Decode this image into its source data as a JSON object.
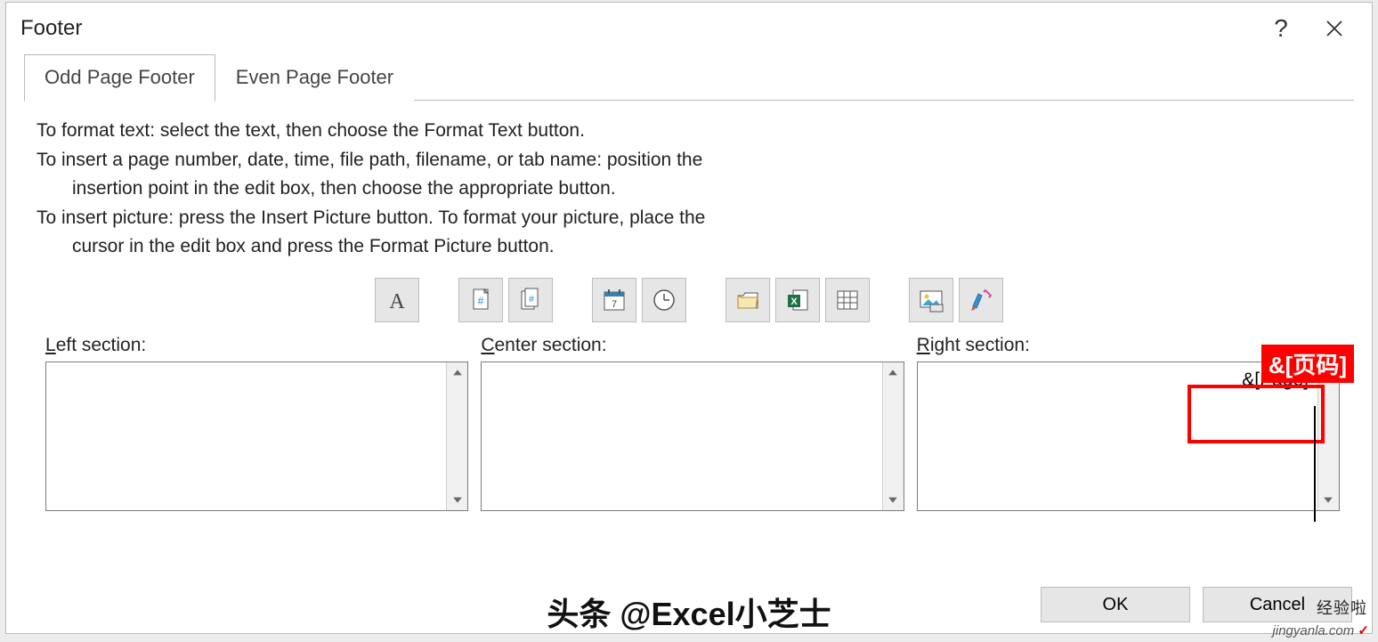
{
  "dialog": {
    "title": "Footer",
    "help": "?",
    "tabs": {
      "odd": "Odd Page Footer",
      "even": "Even Page Footer"
    },
    "instructions": {
      "l1": "To format text:  select the text, then choose the Format Text button.",
      "l2": "To insert a page number, date, time, file path, filename, or tab name:  position the",
      "l2b": "insertion point in the edit box, then choose the appropriate button.",
      "l3": "To insert picture: press the Insert Picture button.  To format your picture, place the",
      "l3b": "cursor in the edit box and press the Format Picture button."
    },
    "sections": {
      "left_prefix": "L",
      "left_rest": "eft section:",
      "center_prefix": "C",
      "center_rest": "enter section:",
      "right_prefix": "R",
      "right_rest": "ight section:",
      "left_value": "",
      "center_value": "",
      "right_value": "&[Page]"
    },
    "buttons": {
      "ok": "OK",
      "cancel": "Cancel"
    }
  },
  "annotation": {
    "badge": "&[页码]"
  },
  "overlay": {
    "text": "头条 @Excel小芝士"
  },
  "watermark": {
    "top": "经验啦",
    "domain": "jingyanla.com"
  }
}
